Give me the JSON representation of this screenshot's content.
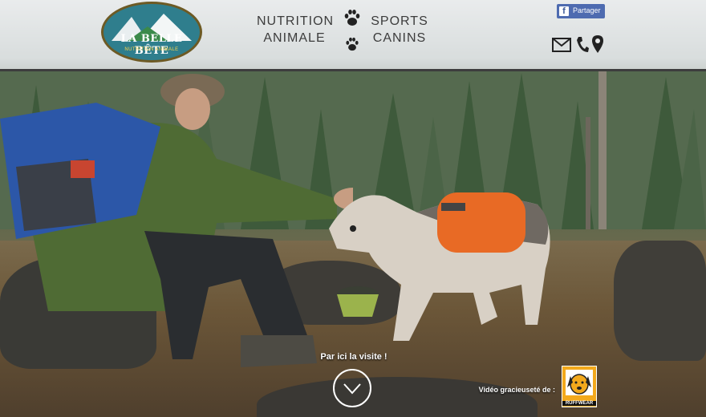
{
  "logo": {
    "name": "LA BELLE BÊTE",
    "tagline": "NUTRITION ANIMALE"
  },
  "nav": {
    "nutrition_line1": "NUTRITION",
    "nutrition_line2": "ANIMALE",
    "sports_line1": "SPORTS",
    "sports_line2": "CANINS"
  },
  "share": {
    "label": "Partager",
    "letter": "f"
  },
  "hero": {
    "visit_label": "Par ici la visite !",
    "credit_label": "Vidéo gracieuseté de :",
    "sponsor_label": "RUFFWEAR"
  },
  "icons": [
    "paw-icon",
    "envelope-icon",
    "phone-icon",
    "map-pin-icon",
    "chevron-down-icon",
    "facebook-icon"
  ],
  "colors": {
    "header_border": "#3d3d3d",
    "facebook": "#4e6bb0",
    "logo_bg": "#2f7e8d",
    "ruffwear": "#f3a91c"
  }
}
